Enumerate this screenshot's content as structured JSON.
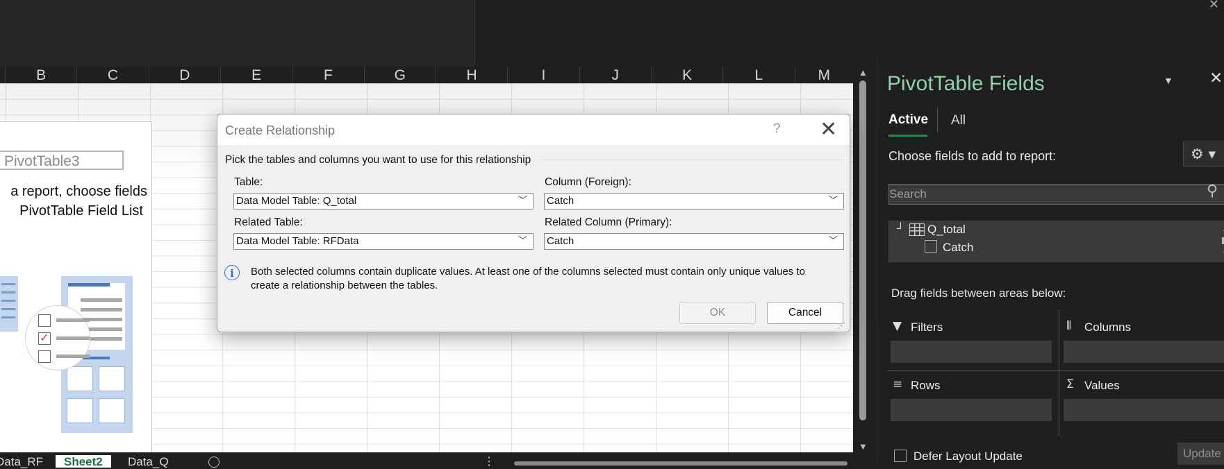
{
  "columns": [
    "B",
    "C",
    "D",
    "E",
    "F",
    "G",
    "H",
    "I",
    "J",
    "K",
    "L",
    "M"
  ],
  "pivot": {
    "name": "PivotTable3",
    "hint_line1": "a report, choose fields",
    "hint_line2": "PivotTable Field List"
  },
  "sheet_tabs": [
    "Data_RF",
    "Sheet2",
    "Data_Q"
  ],
  "dialog": {
    "title": "Create Relationship",
    "help": "?",
    "instructions": "Pick the tables and columns you want to use for this relationship",
    "table_label": "Table:",
    "table_value": "Data Model Table: Q_total",
    "column_label": "Column (Foreign):",
    "column_value": "Catch",
    "related_table_label": "Related Table:",
    "related_table_value": "Data Model Table: RFData",
    "related_column_label": "Related Column (Primary):",
    "related_column_value": "Catch",
    "message": "Both selected columns contain duplicate values. At least one of the columns selected must contain only unique values to create a relationship between the tables.",
    "ok_label": "OK",
    "cancel_label": "Cancel"
  },
  "pane": {
    "title": "PivotTable Fields",
    "tabs": [
      "Active",
      "All"
    ],
    "choose_label": "Choose fields to add to report:",
    "search_placeholder": "Search",
    "table_name": "Q_total",
    "field_name": "Catch",
    "drag_label": "Drag fields between areas below:",
    "areas": [
      "Filters",
      "Columns",
      "Rows",
      "Values"
    ],
    "defer_label": "Defer Layout Update",
    "update_label": "Update"
  },
  "colors": {
    "accent_green": "#8fd3a9",
    "tab_active_green": "#1e7145",
    "info_blue": "#2f6fc6"
  }
}
